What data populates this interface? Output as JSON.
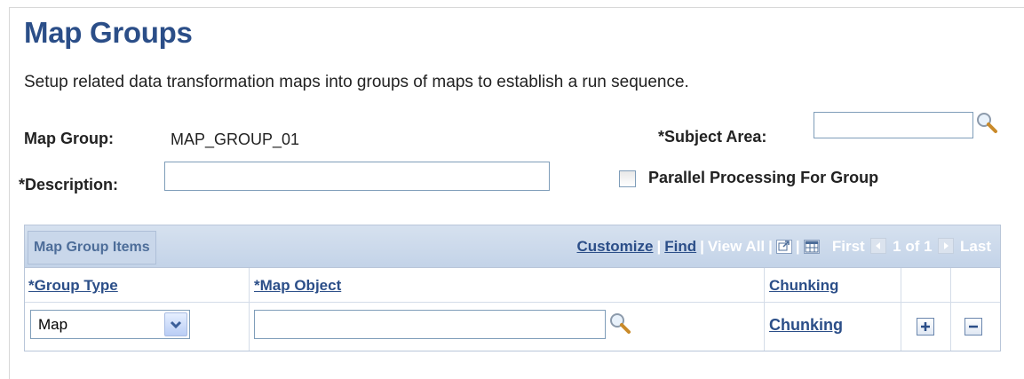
{
  "page": {
    "title": "Map Groups",
    "instructions": "Setup related data transformation maps into groups of maps to establish a run sequence."
  },
  "form": {
    "map_group_label": "Map Group:",
    "map_group_value": "MAP_GROUP_01",
    "subject_area_label": "*Subject Area:",
    "subject_area_value": "",
    "description_label": "*Description:",
    "description_value": "",
    "parallel_label": "Parallel Processing For Group",
    "parallel_checked": false
  },
  "grid": {
    "title": "Map Group Items",
    "nav": {
      "customize": "Customize",
      "find": "Find",
      "view_all": "View All",
      "first": "First",
      "count": "1 of 1",
      "last": "Last",
      "sep": "|"
    },
    "columns": [
      "*Group Type",
      "*Map Object",
      "Chunking"
    ],
    "rows": [
      {
        "group_type": "Map",
        "map_object": "",
        "chunking": "Chunking"
      }
    ]
  },
  "icons": {
    "lookup": "magnifier-icon",
    "dropdown": "chevron-down-icon",
    "add": "plus-icon",
    "remove": "minus-icon"
  },
  "colors": {
    "title": "#2b4e88",
    "link": "#2b4e88",
    "grid_header": "#c9d7ea"
  }
}
